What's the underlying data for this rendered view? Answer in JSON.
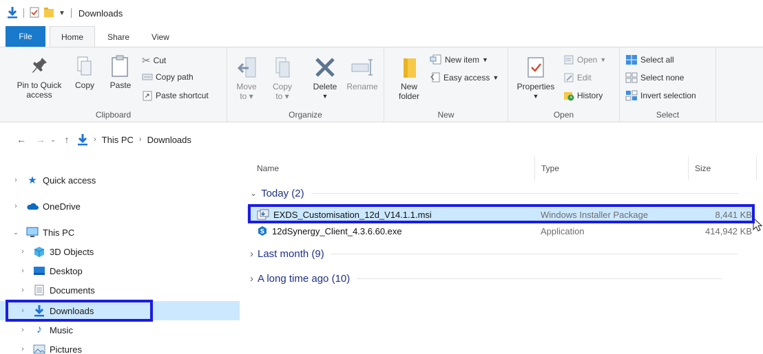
{
  "window": {
    "title": "Downloads"
  },
  "tabs": [
    {
      "label": "File"
    },
    {
      "label": "Home"
    },
    {
      "label": "Share"
    },
    {
      "label": "View"
    }
  ],
  "ribbon": {
    "clipboard": {
      "label": "Clipboard",
      "pin": "Pin to Quick access",
      "pin_line1": "Pin to Quick",
      "pin_line2": "access",
      "copy": "Copy",
      "paste": "Paste",
      "cut": "Cut",
      "copy_path": "Copy path",
      "paste_shortcut": "Paste shortcut"
    },
    "organize": {
      "label": "Organize",
      "move_to_1": "Move",
      "move_to_2": "to",
      "copy_to_1": "Copy",
      "copy_to_2": "to",
      "delete": "Delete",
      "rename": "Rename"
    },
    "new": {
      "label": "New",
      "new_folder_1": "New",
      "new_folder_2": "folder",
      "new_item": "New item",
      "easy_access": "Easy access"
    },
    "open": {
      "label": "Open",
      "properties": "Properties",
      "open": "Open",
      "edit": "Edit",
      "history": "History"
    },
    "select": {
      "label": "Select",
      "select_all": "Select all",
      "select_none": "Select none",
      "invert": "Invert selection"
    }
  },
  "address": {
    "crumbs": [
      "This PC",
      "Downloads"
    ]
  },
  "nav": {
    "items": [
      {
        "label": "Quick access"
      },
      {
        "label": "OneDrive"
      },
      {
        "label": "This PC"
      },
      {
        "label": "3D Objects"
      },
      {
        "label": "Desktop"
      },
      {
        "label": "Documents"
      },
      {
        "label": "Downloads"
      },
      {
        "label": "Music"
      },
      {
        "label": "Pictures"
      }
    ]
  },
  "columns": {
    "name": "Name",
    "type": "Type",
    "size": "Size"
  },
  "groups": [
    {
      "label": "Today (2)"
    },
    {
      "label": "Last month (9)"
    },
    {
      "label": "A long time ago (10)"
    }
  ],
  "files": [
    {
      "name": "EXDS_Customisation_12d_V14.1.1.msi",
      "type": "Windows Installer Package",
      "size": "8,441 KB"
    },
    {
      "name": "12dSynergy_Client_4.3.6.60.exe",
      "type": "Application",
      "size": "414,942 KB"
    }
  ],
  "colors": {
    "accent": "#1979ca",
    "selection": "#cce8ff",
    "highlight_box": "#1c1ce0",
    "group_text": "#1e3287"
  }
}
